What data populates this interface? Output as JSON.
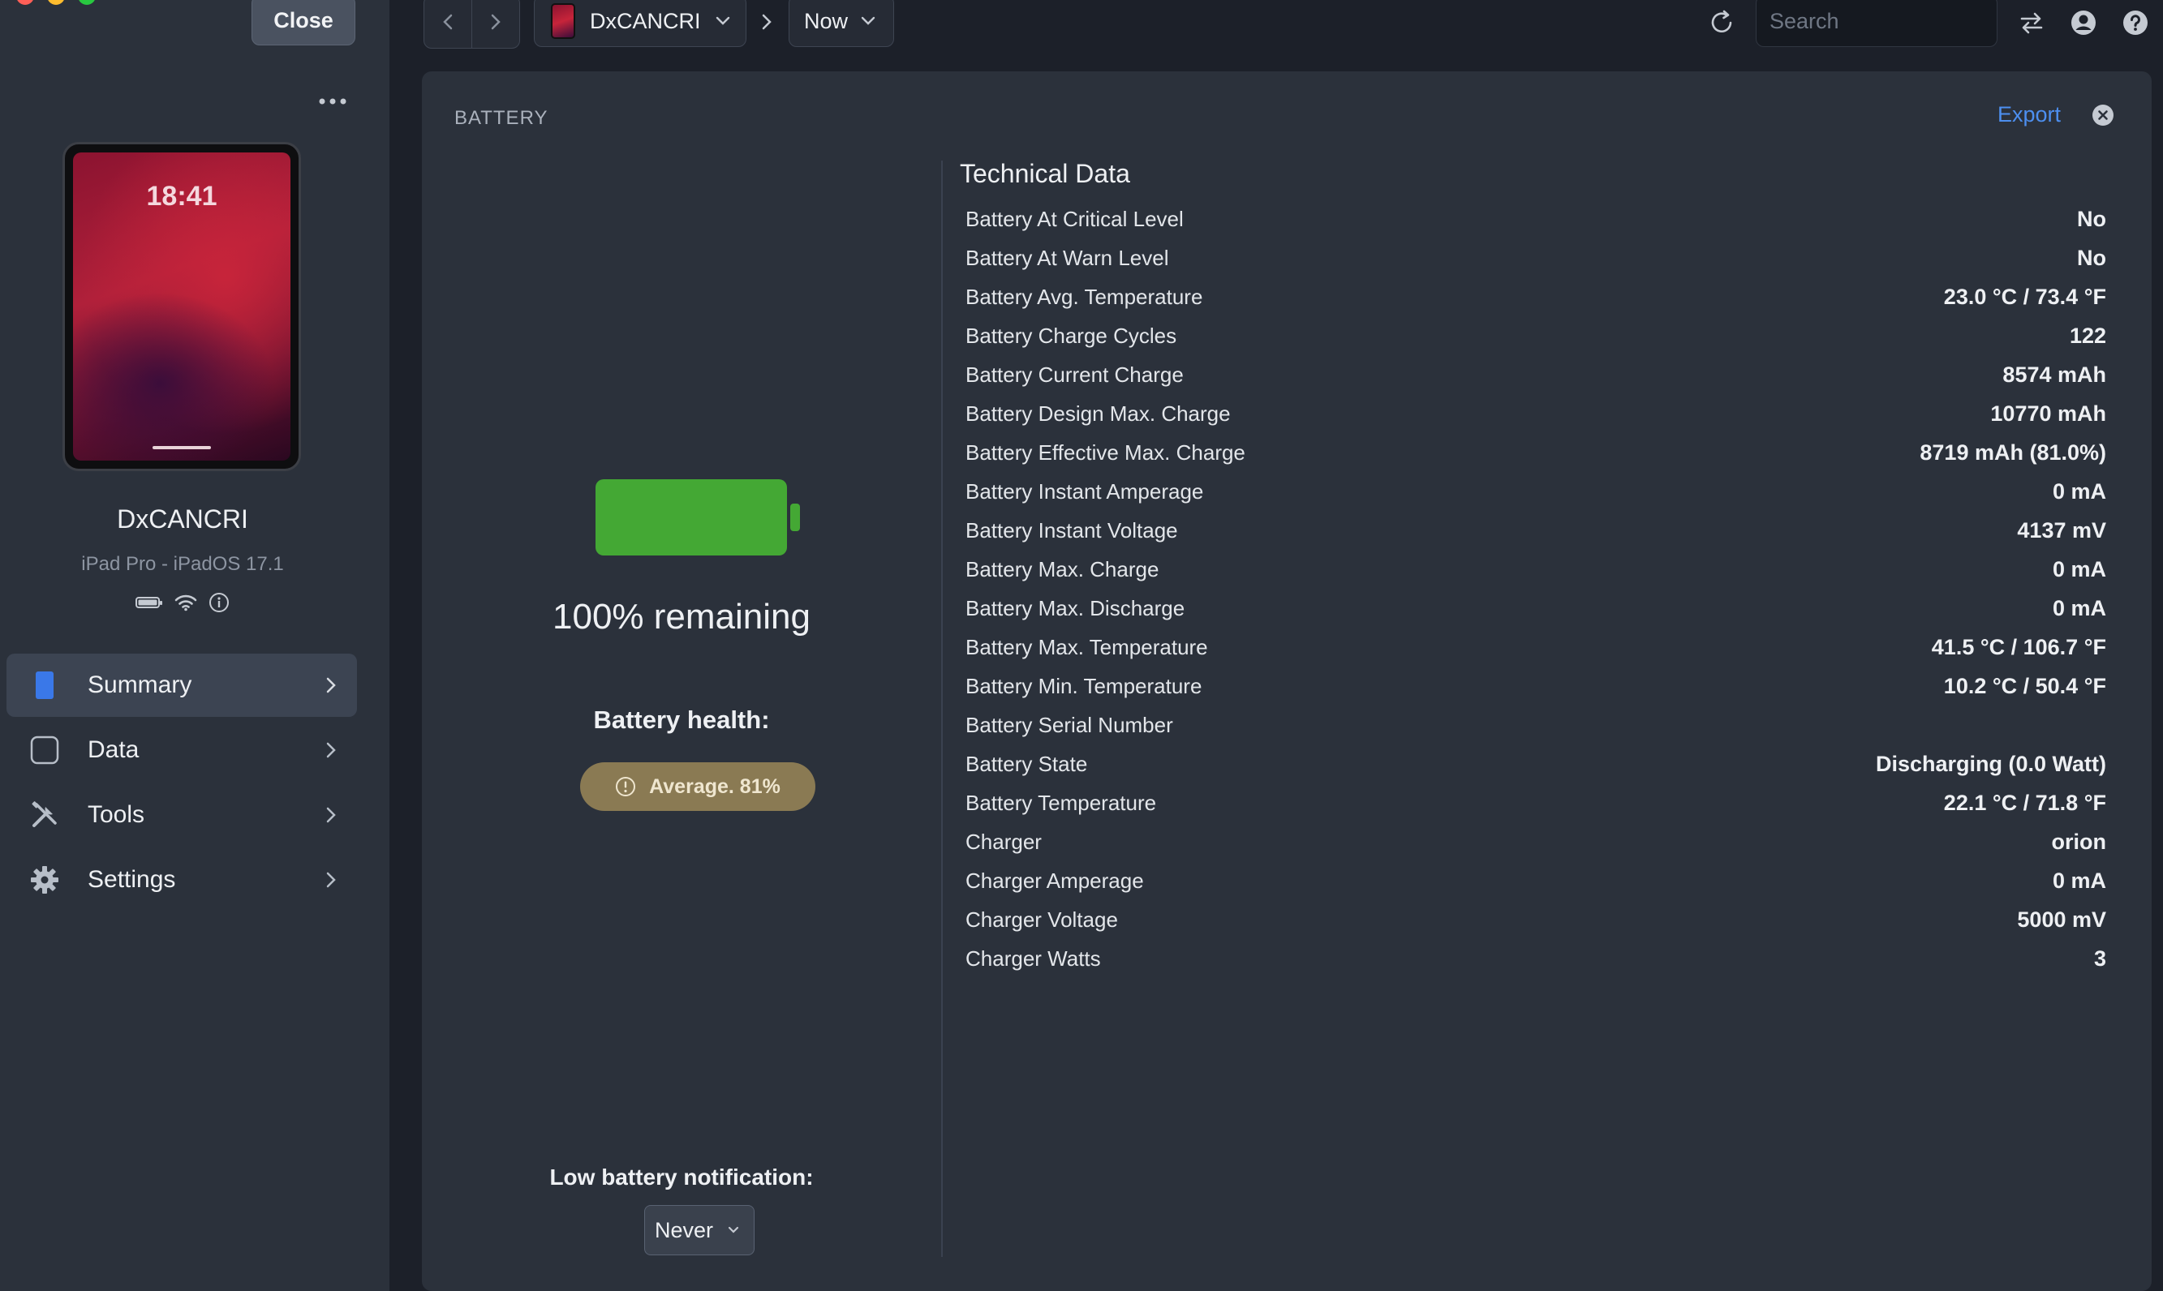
{
  "window": {
    "close_label": "Close",
    "traffic_colors": [
      "#ff5f57",
      "#febc2e",
      "#28c840"
    ]
  },
  "device": {
    "lock_time": "18:41",
    "name": "DxCANCRI",
    "model": "iPad Pro - iPadOS 17.1"
  },
  "sidebar": {
    "items": [
      {
        "label": "Summary",
        "icon": "ipad-icon",
        "active": true
      },
      {
        "label": "Data",
        "icon": "square-icon"
      },
      {
        "label": "Tools",
        "icon": "tools-icon"
      },
      {
        "label": "Settings",
        "icon": "gear-icon"
      }
    ]
  },
  "toolbar": {
    "device_label": "DxCANCRI",
    "time_label": "Now",
    "search_placeholder": "Search"
  },
  "panel": {
    "title": "BATTERY",
    "export_label": "Export",
    "remaining": "100% remaining",
    "charge_level": 1.0,
    "battery_color": "#44a834",
    "health_label": "Battery health:",
    "health_value": "Average. 81%",
    "low_battery_label": "Low battery notification:",
    "low_battery_value": "Never"
  },
  "tech": {
    "title": "Technical Data",
    "rows": [
      {
        "key": "Battery At Critical Level",
        "value": "No"
      },
      {
        "key": "Battery At Warn Level",
        "value": "No"
      },
      {
        "key": "Battery Avg. Temperature",
        "value": "23.0 °C / 73.4 °F"
      },
      {
        "key": "Battery Charge Cycles",
        "value": "122"
      },
      {
        "key": "Battery Current Charge",
        "value": "8574 mAh"
      },
      {
        "key": "Battery Design Max. Charge",
        "value": "10770 mAh"
      },
      {
        "key": "Battery Effective Max. Charge",
        "value": "8719 mAh (81.0%)"
      },
      {
        "key": "Battery Instant Amperage",
        "value": "0 mA"
      },
      {
        "key": "Battery Instant Voltage",
        "value": "4137 mV"
      },
      {
        "key": "Battery Max. Charge",
        "value": "0 mA"
      },
      {
        "key": "Battery Max. Discharge",
        "value": "0 mA"
      },
      {
        "key": "Battery Max. Temperature",
        "value": "41.5 °C / 106.7 °F"
      },
      {
        "key": "Battery Min. Temperature",
        "value": "10.2 °C / 50.4 °F"
      },
      {
        "key": "Battery Serial Number",
        "value": ""
      },
      {
        "key": "Battery State",
        "value": "Discharging (0.0 Watt)"
      },
      {
        "key": "Battery Temperature",
        "value": "22.1 °C / 71.8 °F"
      },
      {
        "key": "Charger",
        "value": "orion"
      },
      {
        "key": "Charger Amperage",
        "value": "0 mA"
      },
      {
        "key": "Charger Voltage",
        "value": "5000 mV"
      },
      {
        "key": "Charger Watts",
        "value": "3"
      }
    ]
  }
}
